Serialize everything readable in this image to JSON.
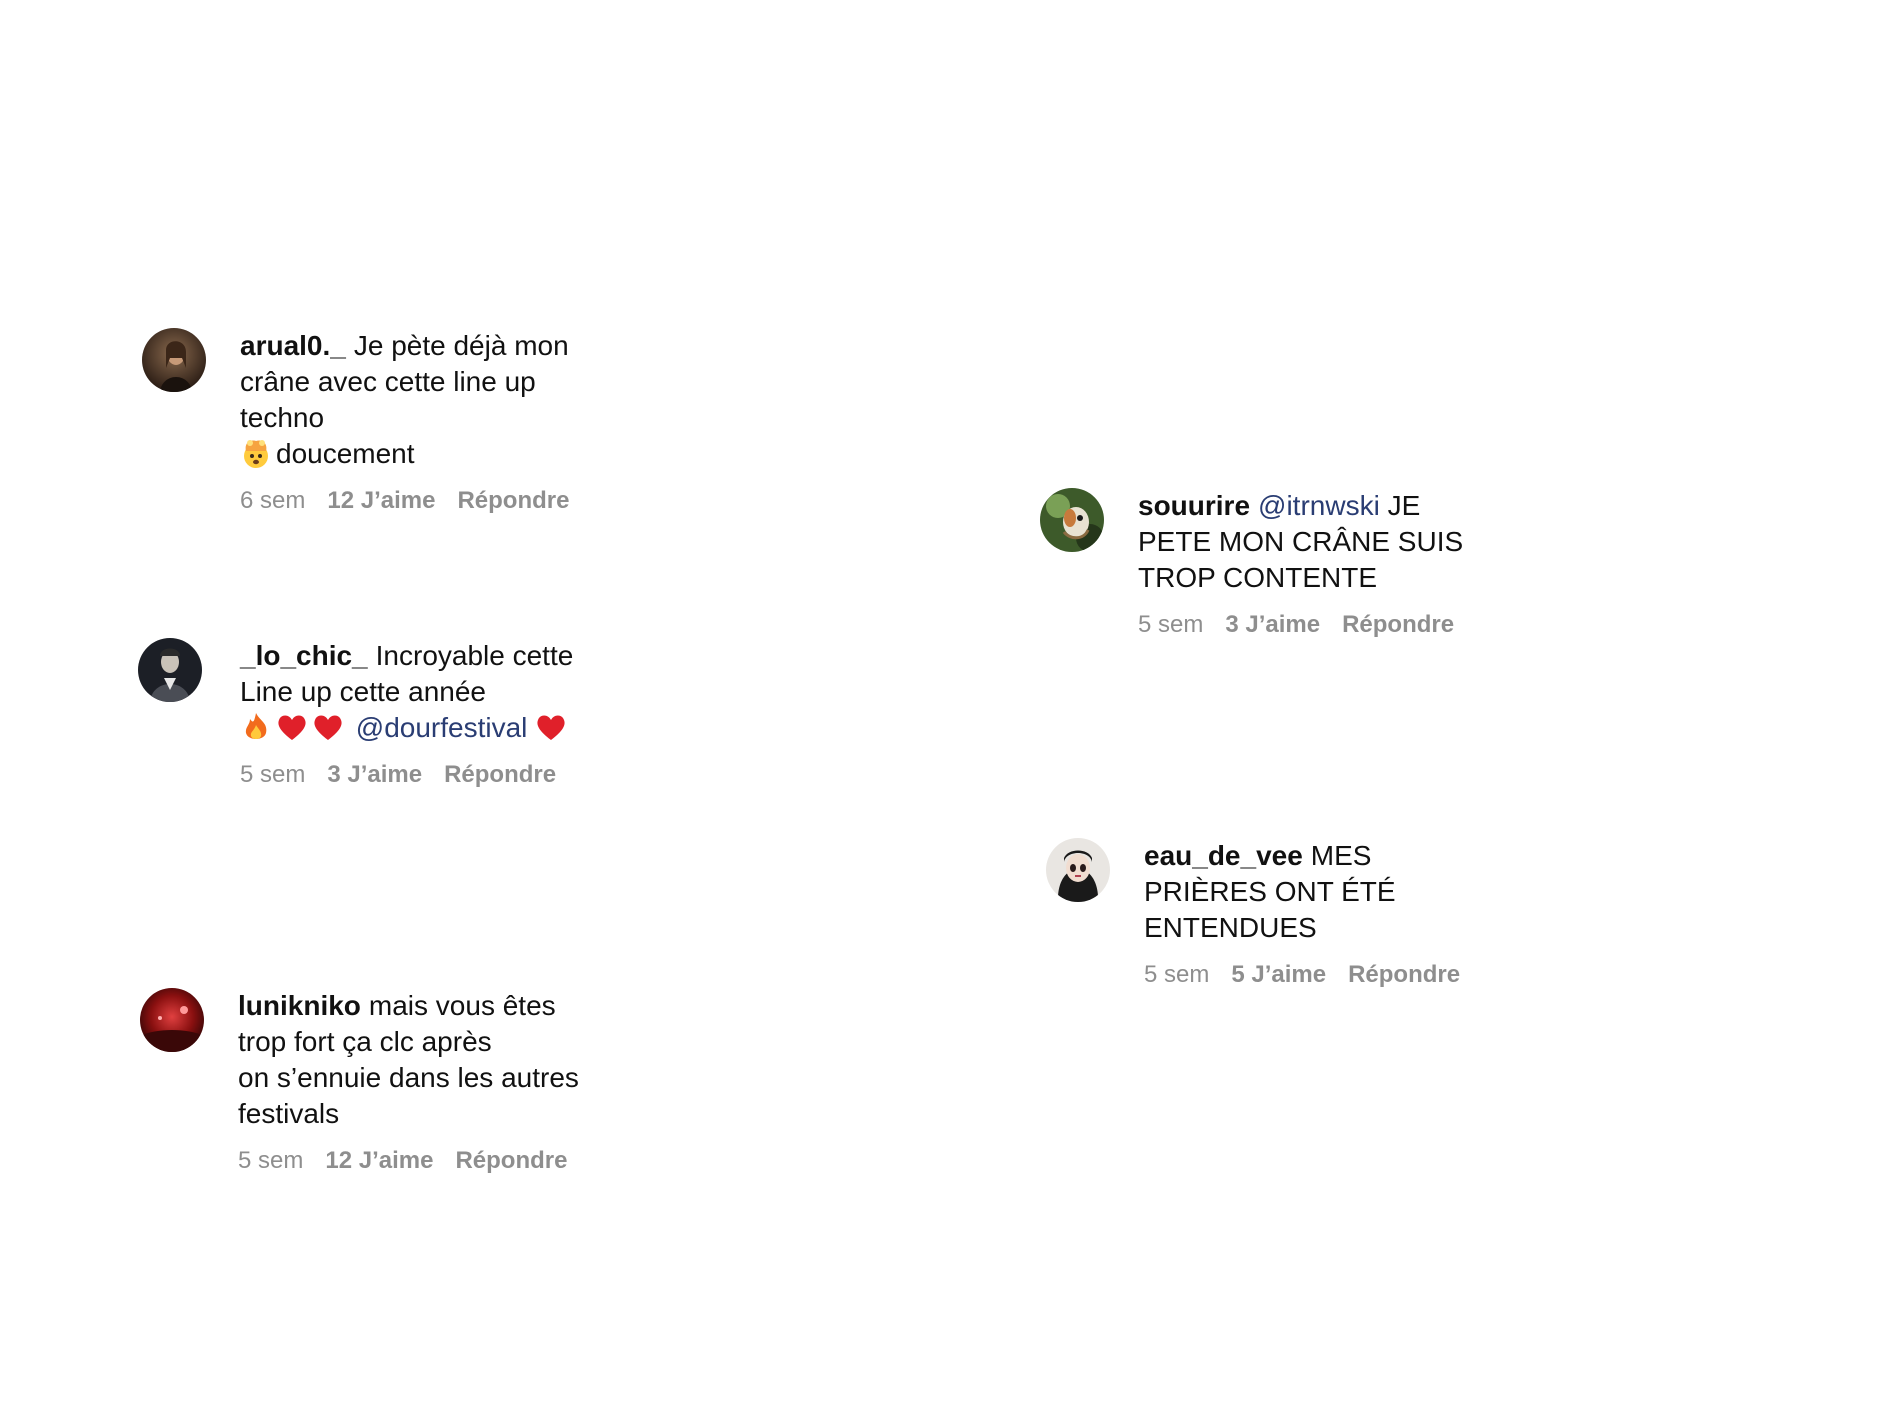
{
  "comments": [
    {
      "username": "arual0._",
      "text_line1": "Je pète déjà mon crâne avec cette line up techno",
      "emoji": "exploding-head",
      "text_line2": "doucement",
      "time": "6 sem",
      "likes": "12 J’aime",
      "reply": "Répondre"
    },
    {
      "username": "souurire",
      "mention": "@itrnwski",
      "text_line1": "JE PETE MON CRÂNE SUIS",
      "text_line2": "TROP CONTENTE",
      "time": "5 sem",
      "likes": "3 J’aime",
      "reply": "Répondre"
    },
    {
      "username": "_lo_chic_",
      "text_line1": "Incroyable cette Line up cette année",
      "emojis_before": [
        "fire",
        "red-heart",
        "red-heart"
      ],
      "mention": "@dourfestival",
      "emoji_after": "red-heart",
      "time": "5 sem",
      "likes": "3 J’aime",
      "reply": "Répondre"
    },
    {
      "username": "eau_de_vee",
      "text_line1": "MES PRIÈRES ONT ÉTÉ",
      "text_line2": "ENTENDUES",
      "time": "5 sem",
      "likes": "5 J’aime",
      "reply": "Répondre"
    },
    {
      "username": "lunikniko",
      "text_line1": "mais vous êtes trop fort ça clc après",
      "text_line2": "on s’ennuie dans les autres festivals",
      "time": "5 sem",
      "likes": "12 J’aime",
      "reply": "Répondre"
    }
  ],
  "colors": {
    "text": "#111111",
    "meta": "#8e8e8e",
    "mention": "#2a3d73",
    "heart": "#e0202a",
    "fire": "#f26b1d"
  }
}
